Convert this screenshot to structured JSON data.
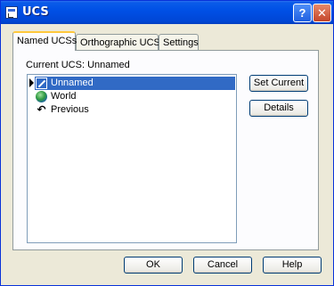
{
  "window": {
    "title": "UCS",
    "help_glyph": "?",
    "close_glyph": "✕"
  },
  "tabs": [
    {
      "label": "Named UCSs",
      "active": true
    },
    {
      "label": "Orthographic UCSs",
      "active": false
    },
    {
      "label": "Settings",
      "active": false
    }
  ],
  "named": {
    "current_label": "Current UCS:  Unnamed",
    "items": [
      {
        "label": "Unnamed",
        "icon": "pencil-icon",
        "selected": true,
        "current": true
      },
      {
        "label": "World",
        "icon": "globe-icon",
        "selected": false,
        "current": false
      },
      {
        "label": "Previous",
        "icon": "previous-arrow-icon",
        "selected": false,
        "current": false
      }
    ],
    "set_current": "Set Current",
    "details": "Details"
  },
  "footer": {
    "ok": "OK",
    "cancel": "Cancel",
    "help": "Help"
  },
  "colors": {
    "titlebar": "#0050e6",
    "selection": "#316ac5",
    "dialog_bg": "#ece9d8"
  }
}
